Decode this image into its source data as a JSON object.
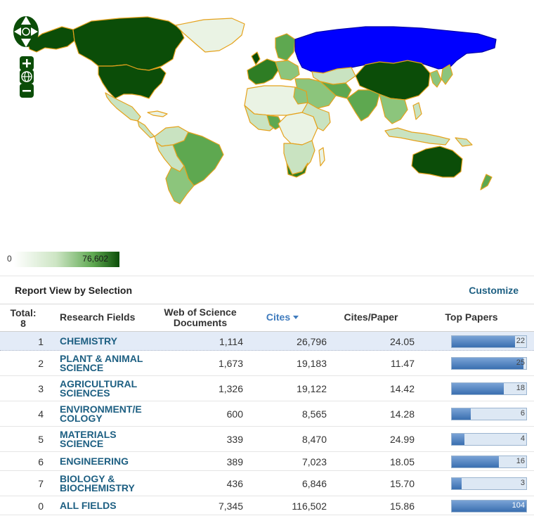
{
  "map": {
    "highlight_color": "#0000ff",
    "border_color": "#e5a21c",
    "scale_colors": [
      "#f5f7ee",
      "#c9e3c1",
      "#8cc57c",
      "#5ea850",
      "#2e7d24",
      "#0b4d08"
    ],
    "controls": {
      "pan": "pan-arrows-icon",
      "zoom_in": "plus-icon",
      "globe": "globe-icon",
      "zoom_out": "minus-icon"
    }
  },
  "legend": {
    "min": "0",
    "max": "76,602"
  },
  "report": {
    "title": "Report View by Selection",
    "customize": "Customize"
  },
  "table": {
    "headers": {
      "total_label": "Total:",
      "total_value": "8",
      "field": "Research Fields",
      "docs_line1": "Web of Science",
      "docs_line2": "Documents",
      "cites": "Cites",
      "cites_per_paper": "Cites/Paper",
      "top_papers": "Top Papers"
    },
    "rows": [
      {
        "rank": "1",
        "field_line1": "CHEMISTRY",
        "field_line2": "",
        "docs": "1,114",
        "cites": "26,796",
        "cpp": "24.05",
        "top": "22",
        "top_fraction": 0.85
      },
      {
        "rank": "2",
        "field_line1": "PLANT & ANIMAL",
        "field_line2": "SCIENCE",
        "docs": "1,673",
        "cites": "19,183",
        "cpp": "11.47",
        "top": "25",
        "top_fraction": 0.96
      },
      {
        "rank": "3",
        "field_line1": "AGRICULTURAL",
        "field_line2": "SCIENCES",
        "docs": "1,326",
        "cites": "19,122",
        "cpp": "14.42",
        "top": "18",
        "top_fraction": 0.7
      },
      {
        "rank": "4",
        "field_line1": "ENVIRONMENT/E",
        "field_line2": "COLOGY",
        "docs": "600",
        "cites": "8,565",
        "cpp": "14.28",
        "top": "6",
        "top_fraction": 0.25
      },
      {
        "rank": "5",
        "field_line1": "MATERIALS",
        "field_line2": "SCIENCE",
        "docs": "339",
        "cites": "8,470",
        "cpp": "24.99",
        "top": "4",
        "top_fraction": 0.17
      },
      {
        "rank": "6",
        "field_line1": "ENGINEERING",
        "field_line2": "",
        "docs": "389",
        "cites": "7,023",
        "cpp": "18.05",
        "top": "16",
        "top_fraction": 0.63
      },
      {
        "rank": "7",
        "field_line1": "BIOLOGY &",
        "field_line2": "BIOCHEMISTRY",
        "docs": "436",
        "cites": "6,846",
        "cpp": "15.70",
        "top": "3",
        "top_fraction": 0.13
      },
      {
        "rank": "0",
        "field_line1": "ALL FIELDS",
        "field_line2": "",
        "docs": "7,345",
        "cites": "116,502",
        "cpp": "15.86",
        "top": "104",
        "top_fraction": 1.0
      }
    ]
  }
}
